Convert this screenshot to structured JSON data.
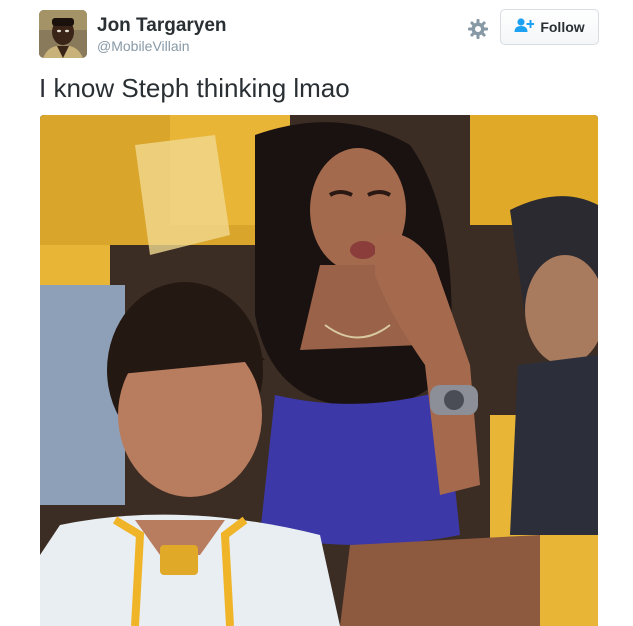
{
  "user": {
    "name": "Jon Targaryen",
    "handle": "@MobileVillain"
  },
  "actions": {
    "settings_icon": "gear-icon",
    "follow_label": "Follow",
    "follow_icon": "add-user-icon"
  },
  "tweet": {
    "text": "I know Steph thinking lmao"
  },
  "colors": {
    "text": "#292f33",
    "muted": "#8899a6",
    "follow_icon": "#1da1f2",
    "border": "#d8dde1"
  }
}
